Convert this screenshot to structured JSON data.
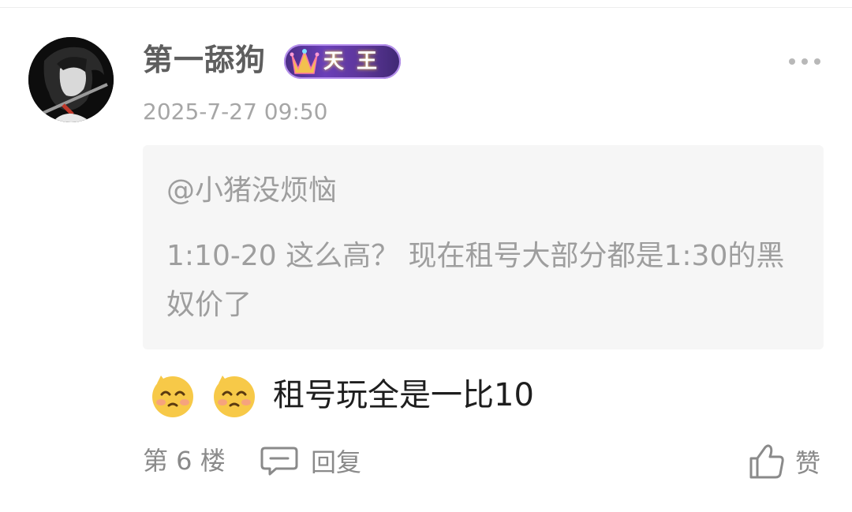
{
  "comment": {
    "username": "第一舔狗",
    "badge_text": "天王",
    "timestamp": "2025-7-27 09:50",
    "quote": {
      "user": "@小猪没烦恼",
      "text": "1:10-20 这么高？ 现在租号大部分都是1:30的黑奴价了"
    },
    "content_text": "租号玩全是一比10",
    "emojis": [
      "pleading-face-emoji",
      "pleading-face-emoji"
    ]
  },
  "footer": {
    "floor": "第 6 楼",
    "reply_label": "回复",
    "like_label": "赞"
  },
  "colors": {
    "username": "#5e5e5e",
    "muted": "#a6a6a6",
    "quote_bg": "#f6f6f6",
    "badge_purple": "#5b3596"
  }
}
